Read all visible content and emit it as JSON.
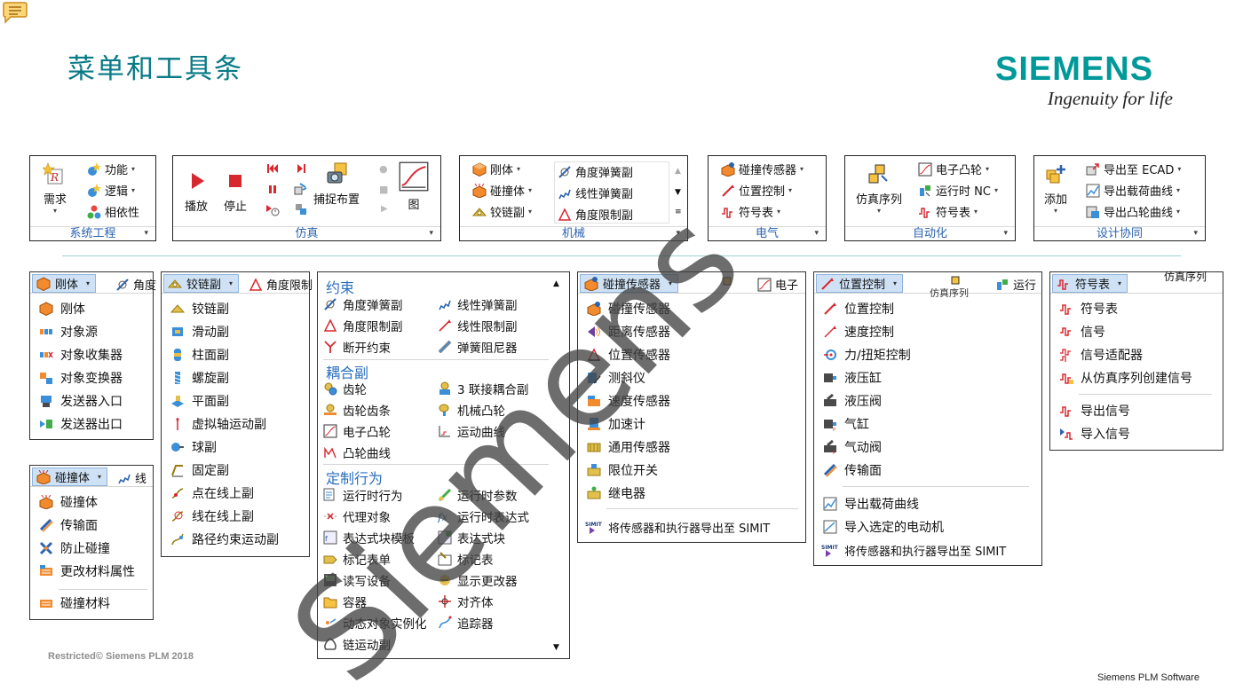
{
  "slide": {
    "title": "菜单和工具条",
    "brand": {
      "name": "SIEMENS",
      "tagline": "Ingenuity for life"
    },
    "footer_left": "Restricted© Siemens PLM 2018",
    "footer_right": "Siemens PLM Software",
    "watermark": "Siemens"
  },
  "colors": {
    "title": "#087a86",
    "brand": "#009999",
    "group_label": "#2b63ae",
    "section": "#2a6fbd",
    "watermark": "#444444"
  },
  "ribbon": {
    "system": {
      "label": "系统工程",
      "big": "需求",
      "items": [
        "功能",
        "逻辑",
        "相依性"
      ]
    },
    "sim": {
      "label": "仿真",
      "play": "播放",
      "stop": "停止",
      "capture": "捕捉布置",
      "graph": "图"
    },
    "mech": {
      "label": "机械",
      "items": [
        "刚体",
        "碰撞体",
        "铰链副"
      ],
      "gallery": [
        "角度弹簧副",
        "线性弹簧副",
        "角度限制副"
      ]
    },
    "elec": {
      "label": "电气",
      "items": [
        "碰撞传感器",
        "位置控制",
        "符号表"
      ]
    },
    "auto": {
      "label": "自动化",
      "big": "仿真序列",
      "items": [
        "电子凸轮",
        "运行时 NC",
        "符号表"
      ]
    },
    "design": {
      "label": "设计协同",
      "big": "添加",
      "items": [
        "导出至 ECAD",
        "导出载荷曲线",
        "导出凸轮曲线"
      ]
    }
  },
  "panels": {
    "rigid": {
      "head": "刚体",
      "ghost": "角度",
      "items": [
        "刚体",
        "对象源",
        "对象收集器",
        "对象变换器",
        "发送器入口",
        "发送器出口"
      ]
    },
    "collision": {
      "head": "碰撞体",
      "ghost": "线",
      "items": [
        "碰撞体",
        "传输面",
        "防止碰撞",
        "更改材料属性"
      ],
      "extra": "碰撞材料"
    },
    "hinge": {
      "head": "铰链副",
      "ghost": "角度限制",
      "items": [
        "铰链副",
        "滑动副",
        "柱面副",
        "螺旋副",
        "平面副",
        "虚拟轴运动副",
        "球副",
        "固定副",
        "点在线上副",
        "线在线上副",
        "路径约束运动副"
      ]
    },
    "constraint": {
      "sections": [
        "约束",
        "耦合副",
        "定制行为"
      ],
      "left": [
        "角度弹簧副",
        "角度限制副",
        "断开约束",
        "齿轮",
        "齿轮齿条",
        "电子凸轮",
        "凸轮曲线",
        "运行时行为",
        "代理对象",
        "表达式块模板",
        "标记表单",
        "读写设备",
        "容器",
        "动态对象实例化",
        "链运动副"
      ],
      "right": [
        "线性弹簧副",
        "线性限制副",
        "弹簧阻尼器",
        "3 联接耦合副",
        "机械凸轮",
        "运动曲线",
        "运行时参数",
        "运行时表达式",
        "表达式块",
        "标记表",
        "显示更改器",
        "对齐体",
        "追踪器"
      ]
    },
    "sensor": {
      "head": "碰撞传感器",
      "ghost": "电子",
      "items": [
        "碰撞传感器",
        "距离传感器",
        "位置传感器",
        "测斜仪",
        "速度传感器",
        "加速计",
        "通用传感器",
        "限位开关",
        "继电器"
      ],
      "simit": "将传感器和执行器导出至 SIMIT",
      "simit_badge": "SIMIT"
    },
    "position": {
      "head": "位置控制",
      "ghost1": "仿真序列",
      "ghost2": "运行",
      "items": [
        "位置控制",
        "速度控制",
        "力/扭矩控制",
        "液压缸",
        "液压阀",
        "气缸",
        "气动阀",
        "传输面"
      ],
      "items2": [
        "导出载荷曲线",
        "导入选定的电动机"
      ],
      "simit": "将传感器和执行器导出至 SIMIT",
      "simit_badge": "SIMIT"
    },
    "symbol": {
      "head": "符号表",
      "ghost": "仿真序列",
      "items": [
        "符号表",
        "信号",
        "信号适配器",
        "从仿真序列创建信号"
      ],
      "items2": [
        "导出信号",
        "导入信号"
      ]
    }
  }
}
